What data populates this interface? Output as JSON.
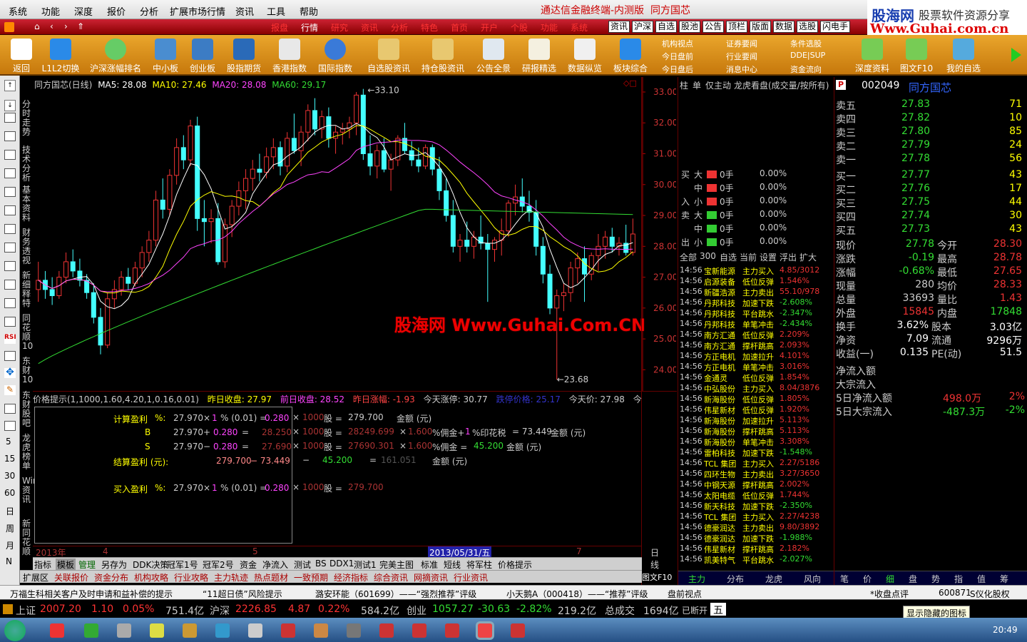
{
  "menubar": {
    "items": [
      "系统",
      "功能",
      "深度",
      "报价",
      "分析",
      "扩展市场行情",
      "资讯",
      "工具",
      "帮助"
    ],
    "title": "通达信金融终端-内测版",
    "stock_title": "同方国芯"
  },
  "brand": {
    "logo": "股海网",
    "tagline": "股票软件资源分享",
    "url": "Www.Guhai.com.cn"
  },
  "navrow": {
    "items": [
      "报盘",
      "行情",
      "研究",
      "资讯",
      "分析",
      "特色",
      "首页",
      "开户",
      "个股",
      "功能",
      "系统"
    ],
    "quick": [
      "资讯",
      "沪深",
      "自选",
      "股池",
      "公告",
      "顶栏",
      "版面",
      "数据",
      "选股",
      "闪电手"
    ]
  },
  "toolbar": {
    "buttons": [
      "返回",
      "L1L2切换",
      "沪深涨幅排名",
      "中小板",
      "创业板",
      "股指期货",
      "香港指数",
      "国际指数",
      "自选股资讯",
      "持仓股资讯",
      "公告全景",
      "研报精选",
      "数据纵览",
      "板块综合"
    ],
    "groups": [
      [
        "机构视点",
        "今日盘前",
        "今日盘后"
      ],
      [
        "证券要闻",
        "行业要闻",
        "消息中心"
      ],
      [
        "条件选股",
        "DDE|SUP",
        "资金流向"
      ]
    ],
    "right": [
      "深度资料",
      "图文F10",
      "我的自选"
    ]
  },
  "left_vertical": [
    "分时走势",
    "技术分析",
    "基本资料",
    "财务透视",
    "新细释特",
    "同花顺10",
    "东财10",
    "东财股吧",
    "龙虎榜单",
    "Wind资讯",
    "新同花顺"
  ],
  "left_small": [
    "5",
    "15",
    "30",
    "60",
    "日",
    "周",
    "月",
    "N"
  ],
  "chart": {
    "legend": {
      "name": "同方国芯(日线)",
      "ma5": "MA5: 28.08",
      "ma10": "MA10: 27.46",
      "ma20": "MA20: 28.08",
      "ma60": "MA60: 29.17"
    },
    "high_label": "33.10",
    "low_label": "23.68",
    "watermark": "股海网 Www.Guhai.Com.CN",
    "x_labels": [
      "2013年",
      "4",
      "5",
      "2013/05/31/五",
      "7"
    ],
    "x_period": "日线"
  },
  "chart_data": {
    "type": "candlestick",
    "ylim": [
      23.5,
      33.3
    ],
    "y_ticks": [
      "33.00",
      "32.00",
      "31.00",
      "30.00",
      "29.00",
      "28.00",
      "27.00",
      "26.00",
      "25.00",
      "24.00"
    ],
    "ohlc": [
      [
        26.6,
        27.5,
        26.2,
        26.9
      ],
      [
        26.9,
        27.2,
        26.3,
        26.6
      ],
      [
        26.6,
        27.0,
        26.1,
        26.4
      ],
      [
        26.4,
        27.2,
        26.3,
        27.0
      ],
      [
        27.0,
        27.8,
        26.8,
        27.5
      ],
      [
        27.5,
        27.9,
        27.0,
        27.2
      ],
      [
        27.2,
        27.6,
        26.7,
        26.9
      ],
      [
        26.9,
        27.1,
        26.3,
        26.5
      ],
      [
        26.5,
        26.8,
        25.5,
        25.7
      ],
      [
        25.7,
        26.0,
        24.5,
        24.8
      ],
      [
        24.8,
        26.5,
        24.7,
        26.3
      ],
      [
        26.3,
        26.9,
        26.0,
        26.6
      ],
      [
        26.6,
        27.2,
        26.4,
        27.0
      ],
      [
        27.0,
        27.3,
        26.6,
        26.8
      ],
      [
        26.8,
        27.5,
        26.7,
        27.3
      ],
      [
        27.3,
        28.0,
        27.0,
        27.8
      ],
      [
        27.8,
        28.5,
        27.5,
        28.2
      ],
      [
        28.2,
        29.8,
        28.0,
        29.5
      ],
      [
        29.5,
        30.2,
        28.9,
        29.2
      ],
      [
        29.2,
        30.5,
        29.0,
        30.3
      ],
      [
        30.3,
        31.5,
        30.0,
        31.2
      ],
      [
        31.2,
        31.6,
        30.5,
        30.8
      ],
      [
        30.8,
        32.1,
        30.6,
        31.9
      ],
      [
        31.9,
        32.2,
        28.5,
        28.9
      ],
      [
        28.9,
        29.5,
        28.0,
        28.8
      ],
      [
        28.8,
        29.2,
        28.1,
        28.9
      ],
      [
        28.9,
        29.4,
        27.4,
        27.5
      ],
      [
        27.5,
        28.9,
        27.3,
        28.7
      ],
      [
        28.7,
        29.5,
        28.3,
        29.3
      ],
      [
        29.3,
        30.1,
        29.0,
        29.8
      ],
      [
        29.8,
        30.5,
        29.2,
        30.2
      ],
      [
        30.2,
        30.8,
        29.8,
        30.5
      ],
      [
        30.5,
        31.0,
        30.1,
        30.4
      ],
      [
        30.4,
        31.2,
        30.2,
        30.9
      ],
      [
        30.9,
        31.5,
        30.5,
        31.2
      ],
      [
        31.2,
        31.4,
        30.3,
        30.6
      ],
      [
        30.6,
        31.7,
        30.4,
        31.5
      ],
      [
        31.5,
        32.3,
        31.0,
        31.1
      ],
      [
        31.1,
        31.9,
        30.6,
        31.7
      ],
      [
        31.7,
        32.6,
        31.4,
        32.4
      ],
      [
        32.4,
        32.8,
        31.6,
        31.8
      ],
      [
        31.8,
        32.4,
        31.5,
        32.2
      ],
      [
        32.2,
        32.5,
        31.2,
        31.5
      ],
      [
        31.5,
        31.9,
        31.0,
        31.7
      ],
      [
        31.7,
        32.0,
        31.3,
        31.8
      ],
      [
        31.8,
        32.2,
        31.5,
        32.0
      ],
      [
        32.0,
        33.0,
        31.6,
        32.9
      ],
      [
        32.9,
        33.1,
        30.8,
        31.0
      ],
      [
        31.0,
        31.6,
        30.3,
        30.6
      ],
      [
        30.6,
        31.3,
        30.2,
        31.1
      ],
      [
        31.1,
        31.5,
        30.4,
        30.5
      ],
      [
        30.5,
        31.0,
        29.8,
        30.8
      ],
      [
        30.8,
        31.6,
        30.6,
        31.5
      ],
      [
        31.5,
        32.0,
        31.0,
        31.1
      ],
      [
        31.1,
        31.4,
        30.6,
        30.8
      ],
      [
        30.8,
        31.2,
        30.4,
        30.6
      ],
      [
        30.6,
        31.3,
        30.5,
        31.2
      ],
      [
        31.2,
        31.3,
        30.3,
        30.5
      ],
      [
        30.5,
        30.9,
        29.5,
        29.8
      ],
      [
        29.8,
        30.2,
        28.8,
        29.0
      ],
      [
        29.0,
        29.5,
        27.8,
        28.0
      ],
      [
        28.0,
        28.4,
        27.5,
        28.2
      ],
      [
        28.2,
        28.8,
        27.8,
        28.0
      ],
      [
        28.0,
        28.5,
        27.6,
        28.3
      ],
      [
        28.3,
        29.0,
        27.9,
        28.1
      ],
      [
        28.1,
        28.4,
        26.2,
        27.9
      ],
      [
        27.9,
        28.3,
        27.5,
        28.2
      ],
      [
        28.2,
        28.9,
        27.7,
        28.5
      ],
      [
        28.5,
        29.5,
        28.3,
        29.4
      ],
      [
        29.4,
        30.0,
        29.0,
        29.6
      ],
      [
        29.6,
        30.2,
        29.1,
        29.3
      ],
      [
        29.3,
        29.8,
        28.8,
        29.1
      ],
      [
        29.1,
        29.5,
        27.7,
        28.0
      ],
      [
        28.0,
        28.3,
        26.8,
        27.1
      ],
      [
        27.1,
        27.4,
        25.8,
        26.0
      ],
      [
        26.0,
        26.6,
        23.68,
        26.4
      ],
      [
        26.4,
        26.8,
        25.9,
        26.5
      ],
      [
        26.5,
        27.5,
        26.2,
        27.3
      ],
      [
        27.3,
        27.8,
        26.8,
        27.6
      ],
      [
        27.6,
        28.0,
        26.2,
        27.1
      ],
      [
        27.1,
        27.8,
        26.9,
        27.7
      ],
      [
        27.7,
        28.4,
        27.2,
        28.0
      ],
      [
        28.0,
        28.5,
        27.6,
        28.3
      ],
      [
        28.3,
        28.6,
        27.8,
        28.0
      ],
      [
        28.0,
        28.3,
        27.7,
        28.1
      ],
      [
        28.1,
        28.7,
        27.7,
        27.8
      ],
      [
        27.8,
        28.9,
        27.7,
        28.4
      ]
    ],
    "series": [
      {
        "name": "MA5",
        "color": "#ffffff"
      },
      {
        "name": "MA10",
        "color": "#ffff00"
      },
      {
        "name": "MA20",
        "color": "#ff44ff"
      },
      {
        "name": "MA60",
        "color": "#33dd33"
      }
    ]
  },
  "infobar": {
    "text1": "价格提示(1,1000,1.60,4.20,1,0.16,0.01)",
    "zs": "昨日收盘: 27.97",
    "qs": "前日收盘: 28.52",
    "zf": "昨日涨幅: -1.93",
    "zt": "今天涨停: 30.77",
    "dt": "跌停价格: 25.17",
    "jj": "今天价: 27.98",
    "jj2": "今天价%"
  },
  "calc": {
    "r1": [
      "计算盈利",
      "%:",
      "27.970",
      "×",
      "1",
      "% (0.01) =",
      "0.280",
      "×",
      "1000",
      "股 =",
      "279.700",
      "金额 (元)"
    ],
    "r2": [
      "B",
      "27.970",
      "+",
      "0.280",
      "=",
      "28.250",
      "×",
      "1000",
      "股 =",
      "28249.699",
      "×",
      "1.600",
      "%佣金+",
      "1",
      "%印花税",
      "= 73.449",
      "金额 (元)"
    ],
    "r3": [
      "S",
      "27.970",
      "−",
      "0.280",
      "=",
      "27.690",
      "×",
      "1000",
      "股 =",
      "27690.301",
      "×",
      "1.600",
      "%佣金 =",
      "45.200",
      "金额 (元)"
    ],
    "r4": [
      "结算盈利 (元):",
      "279.700",
      "− 73.449",
      "−",
      "45.200",
      "=",
      "161.051",
      "金额 (元)"
    ],
    "r5": [
      "买入盈利",
      "%:",
      "27.970",
      "×",
      "1",
      "% (0.01) =",
      "0.280",
      "×",
      "1000",
      "股 =",
      "279.700"
    ]
  },
  "tabs1": [
    "指标",
    "模板",
    "管理",
    "另存为",
    "DDK决策",
    "冠军1号",
    "冠军2号",
    "资金",
    "净流入",
    "测试",
    "BS",
    "DDX1",
    "测试1",
    "完美主图",
    "标准",
    "短线",
    "将军柱",
    "价格提示"
  ],
  "tabs2": [
    "扩展区",
    "关联报价",
    "资金分布",
    "机构攻略",
    "行业攻略",
    "主力轨迹",
    "热点题材",
    "一致预期",
    "经济指标",
    "综合资讯",
    "网摘资讯",
    "行业资讯"
  ],
  "midcol": {
    "header": [
      "柱",
      "单",
      "仅主动",
      "龙虎看盘(成交量/按所有)"
    ],
    "flow": [
      [
        "买",
        "大",
        "0手",
        "0.00%"
      ],
      [
        "",
        "中",
        "0手",
        "0.00%"
      ],
      [
        "入",
        "小",
        "0手",
        "0.00%"
      ],
      [
        "卖",
        "大",
        "0手",
        "0.00%"
      ],
      [
        "",
        "中",
        "0手",
        "0.00%"
      ],
      [
        "出",
        "小",
        "0手",
        "0.00%"
      ]
    ],
    "filters": [
      "全部",
      "300",
      "自选",
      "当前",
      "设置",
      "浮出",
      "扩大"
    ],
    "alerts": [
      [
        "14:56",
        "宝新能源",
        "主力买入",
        "4.85/3012"
      ],
      [
        "14:56",
        "启源装备",
        "低位反弹",
        "1.546%"
      ],
      [
        "14:56",
        "新疆浩源",
        "主力卖出",
        "55.10/978"
      ],
      [
        "14:56",
        "丹邦科技",
        "加速下跌",
        "-2.608%"
      ],
      [
        "14:56",
        "丹邦科技",
        "平台跳水",
        "-2.347%"
      ],
      [
        "14:56",
        "丹邦科技",
        "单笔冲击",
        "-2.434%"
      ],
      [
        "14:56",
        "南方汇通",
        "低位反弹",
        "2.209%"
      ],
      [
        "14:56",
        "南方汇通",
        "撑杆跳高",
        "2.093%"
      ],
      [
        "14:56",
        "方正电机",
        "加速拉升",
        "4.101%"
      ],
      [
        "14:56",
        "方正电机",
        "单笔冲击",
        "3.016%"
      ],
      [
        "14:56",
        "金通灵",
        "低位反弹",
        "1.854%"
      ],
      [
        "14:56",
        "中弘股份",
        "主力买入",
        "8.04/3876"
      ],
      [
        "14:56",
        "新海股份",
        "低位反弹",
        "1.805%"
      ],
      [
        "14:56",
        "伟星新材",
        "低位反弹",
        "1.920%"
      ],
      [
        "14:56",
        "新海股份",
        "加速拉升",
        "5.113%"
      ],
      [
        "14:56",
        "新海股份",
        "撑杆跳高",
        "5.113%"
      ],
      [
        "14:56",
        "新海股份",
        "单笔冲击",
        "3.308%"
      ],
      [
        "14:56",
        "雷柏科技",
        "加速下跌",
        "-1.548%"
      ],
      [
        "14:56",
        "TCL 集团",
        "主力买入",
        "2.27/5186"
      ],
      [
        "14:56",
        "四环生物",
        "主力卖出",
        "3.27/3650"
      ],
      [
        "14:56",
        "中钢天源",
        "撑杆跳高",
        "2.002%"
      ],
      [
        "14:56",
        "太阳电缆",
        "低位反弹",
        "1.744%"
      ],
      [
        "14:56",
        "新天科技",
        "加速下跌",
        "-2.350%"
      ],
      [
        "14:56",
        "TCL 集团",
        "主力买入",
        "2.27/4238"
      ],
      [
        "14:56",
        "德豪润达",
        "主力卖出",
        "9.80/3892"
      ],
      [
        "14:56",
        "德豪润达",
        "加速下跌",
        "-1.988%"
      ],
      [
        "14:56",
        "伟星新材",
        "撑杆跳高",
        "2.182%"
      ],
      [
        "14:56",
        "凯美特气",
        "平台跳水",
        "-2.027%"
      ]
    ],
    "bottom_tabs": [
      "主力",
      "分布",
      "龙虎",
      "风向"
    ]
  },
  "rightcol": {
    "code": "002049",
    "name": "同方国芯",
    "flag": "P",
    "sells": [
      [
        "卖五",
        "27.83",
        "71"
      ],
      [
        "卖四",
        "27.82",
        "10"
      ],
      [
        "卖三",
        "27.80",
        "85"
      ],
      [
        "卖二",
        "27.79",
        "24"
      ],
      [
        "卖一",
        "27.78",
        "56"
      ]
    ],
    "buys": [
      [
        "买一",
        "27.77",
        "43"
      ],
      [
        "买二",
        "27.76",
        "17"
      ],
      [
        "买三",
        "27.75",
        "44"
      ],
      [
        "买四",
        "27.74",
        "30"
      ],
      [
        "买五",
        "27.73",
        "43"
      ]
    ],
    "stats": [
      [
        "现价",
        "27.78",
        "今开",
        "28.30"
      ],
      [
        "涨跌",
        "-0.19",
        "最高",
        "28.78"
      ],
      [
        "涨幅",
        "-0.68%",
        "最低",
        "27.65"
      ],
      [
        "现量",
        "280",
        "均价",
        "28.33"
      ],
      [
        "总量",
        "33693",
        "量比",
        "1.43"
      ],
      [
        "外盘",
        "15845",
        "内盘",
        "17848"
      ],
      [
        "换手",
        "3.62%",
        "股本",
        "3.03亿"
      ],
      [
        "净资",
        "7.09",
        "流通",
        "9296万"
      ],
      [
        "收益(一)",
        "0.135",
        "PE(动)",
        "51.5"
      ]
    ],
    "flows": [
      [
        "净流入额",
        "",
        ""
      ],
      [
        "大宗流入",
        "",
        ""
      ],
      [
        "5日净流入额",
        "498.0万",
        "2%"
      ],
      [
        "5日大宗流入",
        "-487.3万",
        "-2%"
      ]
    ],
    "bottom_tabs": [
      "笔",
      "价",
      "细",
      "盘",
      "势",
      "指",
      "值",
      "筹"
    ]
  },
  "ticker": [
    "万福生科相关客户及时申请和益补偿的提示",
    "“11超日债”风险提示",
    "潞安环能（601699）——“强烈推荐”评级",
    "小天鹅A（000418）——“推荐”评级",
    "盘前视点",
    "*收盘点评",
    "600871",
    "S仪化股权"
  ],
  "status": {
    "sh": "上证",
    "sh_v": "2007.20",
    "sh_c": "1.10",
    "sh_p": "0.05%",
    "sh_a": "751.4亿",
    "sz": "沪深",
    "sz_v": "2226.85",
    "sz_c": "4.87",
    "sz_p": "0.22%",
    "sz_a": "584.2亿",
    "cy": "创业",
    "cy_v": "1057.27",
    "cy_c": "-30.63",
    "cy_p": "-2.82%",
    "cy_a": "219.2亿",
    "total": "总成交",
    "total_v": "1694亿",
    "conn": "已断开",
    "ime": "五"
  },
  "taskbar": {
    "time": "20:49",
    "tooltip": "显示隐藏的图标"
  }
}
